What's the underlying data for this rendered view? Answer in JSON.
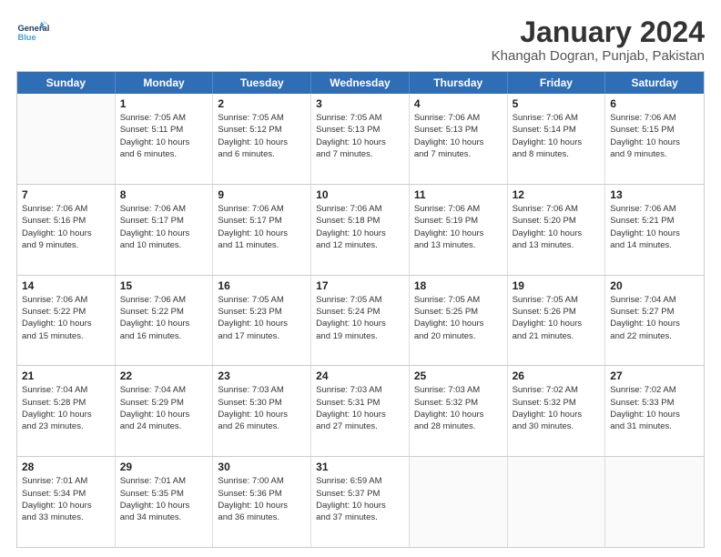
{
  "header": {
    "logo_general": "General",
    "logo_blue": "Blue",
    "month": "January 2024",
    "location": "Khangah Dogran, Punjab, Pakistan"
  },
  "weekdays": [
    "Sunday",
    "Monday",
    "Tuesday",
    "Wednesday",
    "Thursday",
    "Friday",
    "Saturday"
  ],
  "rows": [
    [
      {
        "day": "",
        "info": ""
      },
      {
        "day": "1",
        "info": "Sunrise: 7:05 AM\nSunset: 5:11 PM\nDaylight: 10 hours\nand 6 minutes."
      },
      {
        "day": "2",
        "info": "Sunrise: 7:05 AM\nSunset: 5:12 PM\nDaylight: 10 hours\nand 6 minutes."
      },
      {
        "day": "3",
        "info": "Sunrise: 7:05 AM\nSunset: 5:13 PM\nDaylight: 10 hours\nand 7 minutes."
      },
      {
        "day": "4",
        "info": "Sunrise: 7:06 AM\nSunset: 5:13 PM\nDaylight: 10 hours\nand 7 minutes."
      },
      {
        "day": "5",
        "info": "Sunrise: 7:06 AM\nSunset: 5:14 PM\nDaylight: 10 hours\nand 8 minutes."
      },
      {
        "day": "6",
        "info": "Sunrise: 7:06 AM\nSunset: 5:15 PM\nDaylight: 10 hours\nand 9 minutes."
      }
    ],
    [
      {
        "day": "7",
        "info": "Sunrise: 7:06 AM\nSunset: 5:16 PM\nDaylight: 10 hours\nand 9 minutes."
      },
      {
        "day": "8",
        "info": "Sunrise: 7:06 AM\nSunset: 5:17 PM\nDaylight: 10 hours\nand 10 minutes."
      },
      {
        "day": "9",
        "info": "Sunrise: 7:06 AM\nSunset: 5:17 PM\nDaylight: 10 hours\nand 11 minutes."
      },
      {
        "day": "10",
        "info": "Sunrise: 7:06 AM\nSunset: 5:18 PM\nDaylight: 10 hours\nand 12 minutes."
      },
      {
        "day": "11",
        "info": "Sunrise: 7:06 AM\nSunset: 5:19 PM\nDaylight: 10 hours\nand 13 minutes."
      },
      {
        "day": "12",
        "info": "Sunrise: 7:06 AM\nSunset: 5:20 PM\nDaylight: 10 hours\nand 13 minutes."
      },
      {
        "day": "13",
        "info": "Sunrise: 7:06 AM\nSunset: 5:21 PM\nDaylight: 10 hours\nand 14 minutes."
      }
    ],
    [
      {
        "day": "14",
        "info": "Sunrise: 7:06 AM\nSunset: 5:22 PM\nDaylight: 10 hours\nand 15 minutes."
      },
      {
        "day": "15",
        "info": "Sunrise: 7:06 AM\nSunset: 5:22 PM\nDaylight: 10 hours\nand 16 minutes."
      },
      {
        "day": "16",
        "info": "Sunrise: 7:05 AM\nSunset: 5:23 PM\nDaylight: 10 hours\nand 17 minutes."
      },
      {
        "day": "17",
        "info": "Sunrise: 7:05 AM\nSunset: 5:24 PM\nDaylight: 10 hours\nand 19 minutes."
      },
      {
        "day": "18",
        "info": "Sunrise: 7:05 AM\nSunset: 5:25 PM\nDaylight: 10 hours\nand 20 minutes."
      },
      {
        "day": "19",
        "info": "Sunrise: 7:05 AM\nSunset: 5:26 PM\nDaylight: 10 hours\nand 21 minutes."
      },
      {
        "day": "20",
        "info": "Sunrise: 7:04 AM\nSunset: 5:27 PM\nDaylight: 10 hours\nand 22 minutes."
      }
    ],
    [
      {
        "day": "21",
        "info": "Sunrise: 7:04 AM\nSunset: 5:28 PM\nDaylight: 10 hours\nand 23 minutes."
      },
      {
        "day": "22",
        "info": "Sunrise: 7:04 AM\nSunset: 5:29 PM\nDaylight: 10 hours\nand 24 minutes."
      },
      {
        "day": "23",
        "info": "Sunrise: 7:03 AM\nSunset: 5:30 PM\nDaylight: 10 hours\nand 26 minutes."
      },
      {
        "day": "24",
        "info": "Sunrise: 7:03 AM\nSunset: 5:31 PM\nDaylight: 10 hours\nand 27 minutes."
      },
      {
        "day": "25",
        "info": "Sunrise: 7:03 AM\nSunset: 5:32 PM\nDaylight: 10 hours\nand 28 minutes."
      },
      {
        "day": "26",
        "info": "Sunrise: 7:02 AM\nSunset: 5:32 PM\nDaylight: 10 hours\nand 30 minutes."
      },
      {
        "day": "27",
        "info": "Sunrise: 7:02 AM\nSunset: 5:33 PM\nDaylight: 10 hours\nand 31 minutes."
      }
    ],
    [
      {
        "day": "28",
        "info": "Sunrise: 7:01 AM\nSunset: 5:34 PM\nDaylight: 10 hours\nand 33 minutes."
      },
      {
        "day": "29",
        "info": "Sunrise: 7:01 AM\nSunset: 5:35 PM\nDaylight: 10 hours\nand 34 minutes."
      },
      {
        "day": "30",
        "info": "Sunrise: 7:00 AM\nSunset: 5:36 PM\nDaylight: 10 hours\nand 36 minutes."
      },
      {
        "day": "31",
        "info": "Sunrise: 6:59 AM\nSunset: 5:37 PM\nDaylight: 10 hours\nand 37 minutes."
      },
      {
        "day": "",
        "info": ""
      },
      {
        "day": "",
        "info": ""
      },
      {
        "day": "",
        "info": ""
      }
    ]
  ]
}
